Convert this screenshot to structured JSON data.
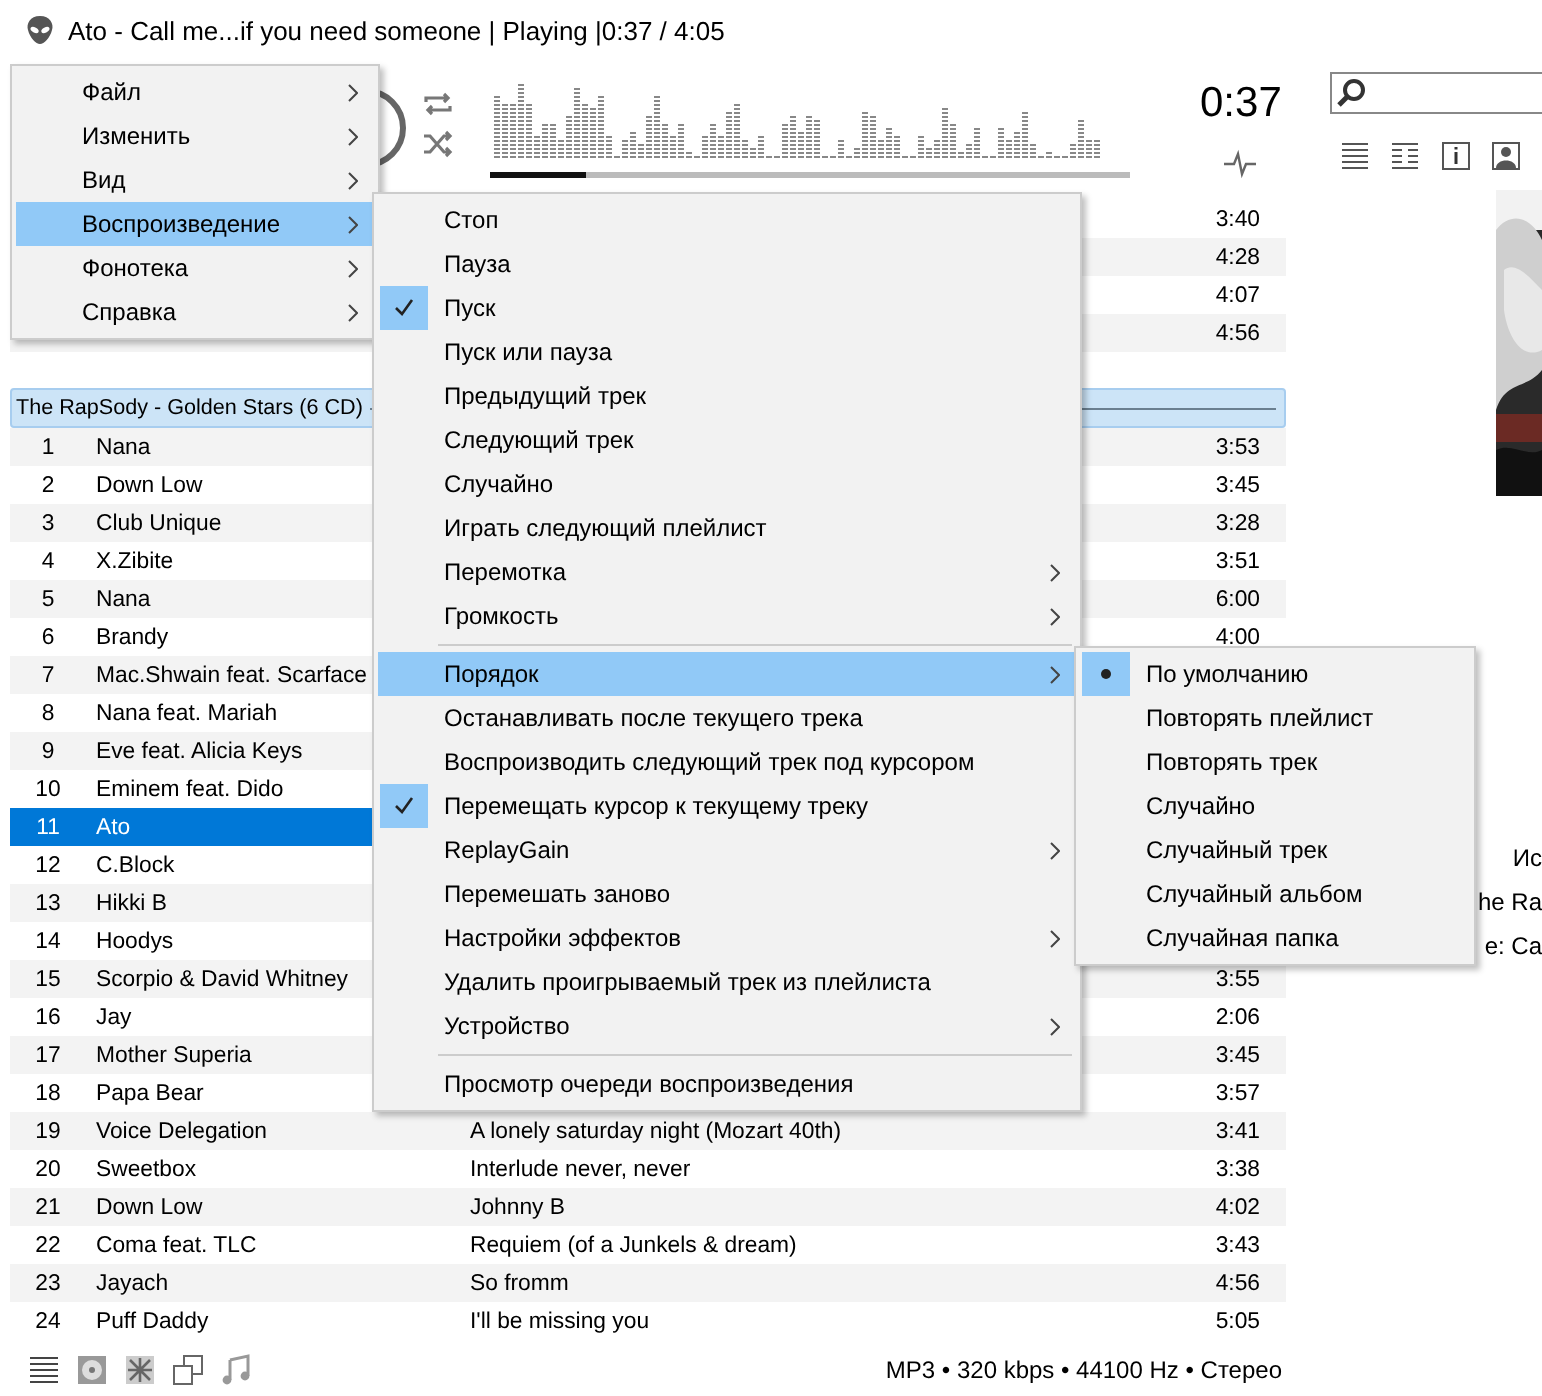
{
  "window": {
    "title": "Ato - Call me...if you need someone | Playing |0:37 / 4:05"
  },
  "player": {
    "time": "0:37",
    "progress": {
      "level": 0.15
    }
  },
  "playlist": {
    "rows": [
      {
        "kind": "track",
        "duration": "3:40",
        "selected": false,
        "shaded": false
      },
      {
        "kind": "track",
        "duration": "4:28",
        "selected": false,
        "shaded": true
      },
      {
        "kind": "track",
        "duration": "4:07",
        "selected": false,
        "shaded": false
      },
      {
        "kind": "track",
        "duration": "4:56",
        "selected": false,
        "shaded": true
      },
      {
        "kind": "group",
        "title": "The RapSody - Golden Stars (6 CD)"
      },
      {
        "kind": "track",
        "number": "1",
        "artist": "Nana",
        "duration": "3:53",
        "selected": false,
        "shaded": true
      },
      {
        "kind": "track",
        "number": "2",
        "artist": "Down Low",
        "duration": "3:45",
        "selected": false,
        "shaded": false
      },
      {
        "kind": "track",
        "number": "3",
        "artist": "Club Unique",
        "duration": "3:28",
        "selected": false,
        "shaded": true
      },
      {
        "kind": "track",
        "number": "4",
        "artist": "X.Zibite",
        "duration": "3:51",
        "selected": false,
        "shaded": false
      },
      {
        "kind": "track",
        "number": "5",
        "artist": "Nana",
        "duration": "6:00",
        "selected": false,
        "shaded": true
      },
      {
        "kind": "track",
        "number": "6",
        "artist": "Brandy",
        "duration": "4:00",
        "selected": false,
        "shaded": false
      },
      {
        "kind": "track",
        "number": "7",
        "artist": "Mac.Shwain feat. Scarface",
        "selected": false,
        "shaded": true
      },
      {
        "kind": "track",
        "number": "8",
        "artist": "Nana feat. Mariah",
        "selected": false,
        "shaded": false
      },
      {
        "kind": "track",
        "number": "9",
        "artist": "Eve feat. Alicia Keys",
        "selected": false,
        "shaded": true
      },
      {
        "kind": "track",
        "number": "10",
        "artist": "Eminem feat. Dido",
        "selected": false,
        "shaded": false
      },
      {
        "kind": "track",
        "number": "11",
        "artist": "Ato",
        "selected": true,
        "shaded": true
      },
      {
        "kind": "track",
        "number": "12",
        "artist": "C.Block",
        "selected": false,
        "shaded": false
      },
      {
        "kind": "track",
        "number": "13",
        "artist": "Hikki B",
        "selected": false,
        "shaded": true
      },
      {
        "kind": "track",
        "number": "14",
        "artist": "Hoodys",
        "selected": false,
        "shaded": false
      },
      {
        "kind": "track",
        "number": "15",
        "artist": "Scorpio & David Whitney",
        "duration": "3:55",
        "selected": false,
        "shaded": true
      },
      {
        "kind": "track",
        "number": "16",
        "artist": "Jay",
        "duration": "2:06",
        "selected": false,
        "shaded": false
      },
      {
        "kind": "track",
        "number": "17",
        "artist": "Mother Superia",
        "duration": "3:45",
        "selected": false,
        "shaded": true
      },
      {
        "kind": "track",
        "number": "18",
        "artist": "Papa Bear",
        "duration": "3:57",
        "selected": false,
        "shaded": false
      },
      {
        "kind": "track",
        "number": "19",
        "artist": "Voice Delegation",
        "title": "A lonely saturday night (Mozart 40th)",
        "duration": "3:41",
        "selected": false,
        "shaded": true
      },
      {
        "kind": "track",
        "number": "20",
        "artist": "Sweetbox",
        "title": "Interlude never, never",
        "duration": "3:38",
        "selected": false,
        "shaded": false
      },
      {
        "kind": "track",
        "number": "21",
        "artist": "Down Low",
        "title": "Johnny B",
        "duration": "4:02",
        "selected": false,
        "shaded": true
      },
      {
        "kind": "track",
        "number": "22",
        "artist": "Coma feat. TLC",
        "title": "Requiem (of a Junkels & dream)",
        "duration": "3:43",
        "selected": false,
        "shaded": false
      },
      {
        "kind": "track",
        "number": "23",
        "artist": "Jayach",
        "title": "So fromm",
        "duration": "4:56",
        "selected": false,
        "shaded": true
      },
      {
        "kind": "track",
        "number": "24",
        "artist": "Puff Daddy",
        "title": "I'll be missing you",
        "duration": "5:05",
        "selected": false,
        "shaded": false
      }
    ]
  },
  "now_playing_info": [
    "Ис",
    "he Ra",
    "e: Ca"
  ],
  "status_bar": {
    "format": "MP3 • 320 kbps • 44100 Hz • Стерео"
  },
  "menus": [
    {
      "kind": "plain",
      "items": [
        {
          "kind": "item",
          "label": "Файл",
          "submenu": true,
          "selected": false
        },
        {
          "kind": "item",
          "label": "Изменить",
          "submenu": true,
          "selected": false
        },
        {
          "kind": "item",
          "label": "Вид",
          "submenu": true,
          "selected": false
        },
        {
          "kind": "item",
          "label": "Воспроизведение",
          "submenu": true,
          "selected": true
        },
        {
          "kind": "item",
          "label": "Фонотека",
          "submenu": true,
          "selected": false
        },
        {
          "kind": "item",
          "label": "Справка",
          "submenu": true,
          "selected": false
        }
      ]
    },
    {
      "kind": "check",
      "items": [
        {
          "kind": "item",
          "label": "Стоп",
          "submenu": false,
          "selected": false,
          "checked": false
        },
        {
          "kind": "item",
          "label": "Пауза",
          "submenu": false,
          "selected": false,
          "checked": false
        },
        {
          "kind": "item",
          "label": "Пуск",
          "submenu": false,
          "selected": false,
          "checked": true
        },
        {
          "kind": "item",
          "label": "Пуск или пауза",
          "submenu": false,
          "selected": false,
          "checked": false
        },
        {
          "kind": "item",
          "label": "Предыдущий трек",
          "submenu": false,
          "selected": false,
          "checked": false
        },
        {
          "kind": "item",
          "label": "Следующий трек",
          "submenu": false,
          "selected": false,
          "checked": false
        },
        {
          "kind": "item",
          "label": "Случайно",
          "submenu": false,
          "selected": false,
          "checked": false
        },
        {
          "kind": "item",
          "label": "Играть следующий плейлист",
          "submenu": false,
          "selected": false,
          "checked": false
        },
        {
          "kind": "item",
          "label": "Перемотка",
          "submenu": true,
          "selected": false,
          "checked": false
        },
        {
          "kind": "item",
          "label": "Громкость",
          "submenu": true,
          "selected": false,
          "checked": false
        },
        {
          "kind": "separator"
        },
        {
          "kind": "item",
          "label": "Порядок",
          "submenu": true,
          "selected": true,
          "checked": false
        },
        {
          "kind": "item",
          "label": "Останавливать после текущего трека",
          "submenu": false,
          "selected": false,
          "checked": false
        },
        {
          "kind": "item",
          "label": "Воспроизводить следующий трек под курсором",
          "submenu": false,
          "selected": false,
          "checked": false
        },
        {
          "kind": "item",
          "label": "Перемещать курсор к текущему треку",
          "submenu": false,
          "selected": false,
          "checked": true
        },
        {
          "kind": "item",
          "label": "ReplayGain",
          "submenu": true,
          "selected": false,
          "checked": false
        },
        {
          "kind": "item",
          "label": "Перемешать заново",
          "submenu": false,
          "selected": false,
          "checked": false
        },
        {
          "kind": "item",
          "label": "Настройки эффектов",
          "submenu": true,
          "selected": false,
          "checked": false
        },
        {
          "kind": "item",
          "label": "Удалить проигрываемый трек из плейлиста",
          "submenu": false,
          "selected": false,
          "checked": false
        },
        {
          "kind": "item",
          "label": "Устройство",
          "submenu": true,
          "selected": false,
          "checked": false
        },
        {
          "kind": "separator"
        },
        {
          "kind": "item",
          "label": "Просмотр очереди воспроизведения",
          "submenu": false,
          "selected": false,
          "checked": false
        }
      ]
    },
    {
      "kind": "radio",
      "items": [
        {
          "kind": "item",
          "label": "По умолчанию",
          "submenu": false,
          "selected": false,
          "checked": true
        },
        {
          "kind": "item",
          "label": "Повторять плейлист",
          "submenu": false,
          "selected": false,
          "checked": false
        },
        {
          "kind": "item",
          "label": "Повторять трек",
          "submenu": false,
          "selected": false,
          "checked": false
        },
        {
          "kind": "item",
          "label": "Случайно",
          "submenu": false,
          "selected": false,
          "checked": false
        },
        {
          "kind": "item",
          "label": "Случайный трек",
          "submenu": false,
          "selected": false,
          "checked": false
        },
        {
          "kind": "item",
          "label": "Случайный альбом",
          "submenu": false,
          "selected": false,
          "checked": false
        },
        {
          "kind": "item",
          "label": "Случайная папка",
          "submenu": false,
          "selected": false,
          "checked": false
        }
      ]
    }
  ]
}
